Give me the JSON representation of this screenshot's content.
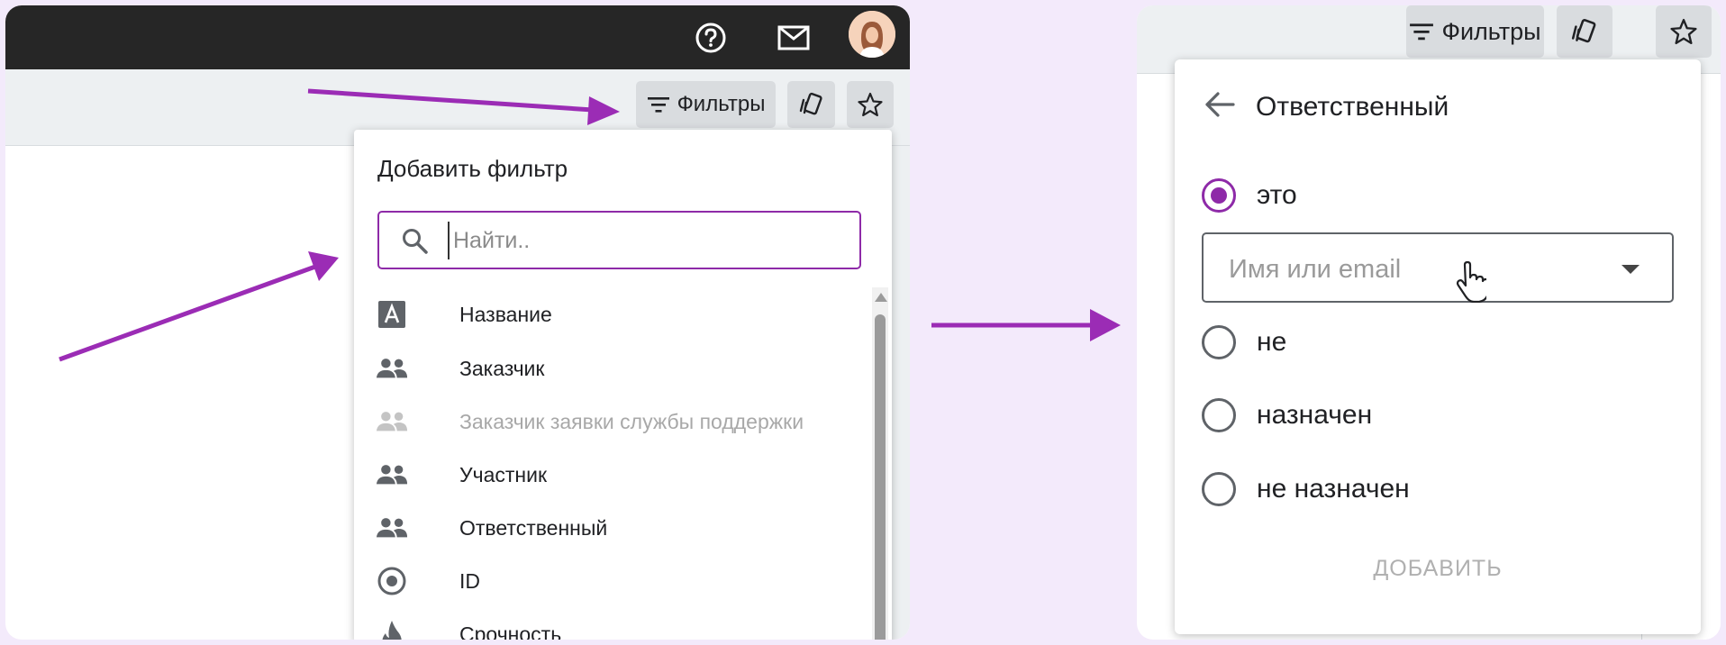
{
  "left": {
    "toolbar": {
      "filters_label": "Фильтры"
    },
    "dropdown": {
      "title": "Добавить фильтр",
      "search_placeholder": "Найти..",
      "items": [
        {
          "label": "Название",
          "icon": "text-field-icon",
          "disabled": false
        },
        {
          "label": "Заказчик",
          "icon": "people-icon",
          "disabled": false
        },
        {
          "label": "Заказчик заявки службы поддержки",
          "icon": "people-icon",
          "disabled": true
        },
        {
          "label": "Участник",
          "icon": "people-icon",
          "disabled": false
        },
        {
          "label": "Ответственный",
          "icon": "people-icon",
          "disabled": false
        },
        {
          "label": "ID",
          "icon": "radio-button-icon",
          "disabled": false
        },
        {
          "label": "Срочность",
          "icon": "flame-icon",
          "disabled": false
        }
      ]
    }
  },
  "right": {
    "toolbar": {
      "filters_label": "Фильтры"
    },
    "panel": {
      "title": "Ответственный",
      "options": [
        {
          "label": "это",
          "checked": true
        },
        {
          "label": "не",
          "checked": false
        },
        {
          "label": "назначен",
          "checked": false
        },
        {
          "label": "не назначен",
          "checked": false
        }
      ],
      "select_placeholder": "Имя или email",
      "add_button": "ДОБАВИТЬ"
    }
  },
  "colors": {
    "accent": "#8e2aa8",
    "topbar": "#262626",
    "toolbar": "#edf0f2"
  }
}
